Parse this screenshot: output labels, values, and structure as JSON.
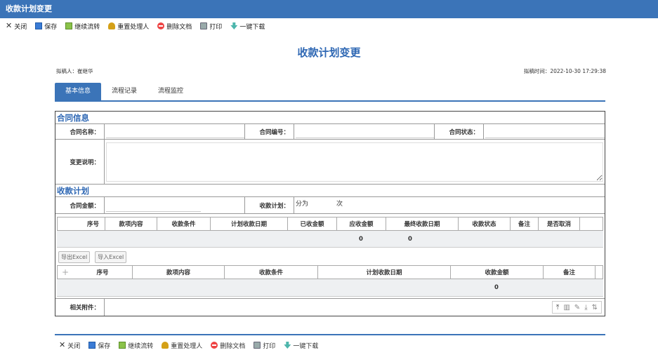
{
  "window": {
    "title": "收款计划变更"
  },
  "toolbar": {
    "items": [
      {
        "label": "关闭",
        "icon": "close-icon"
      },
      {
        "label": "保存",
        "icon": "save-icon"
      },
      {
        "label": "继续流转",
        "icon": "flow-icon"
      },
      {
        "label": "重置处理人",
        "icon": "user-icon"
      },
      {
        "label": "删除文档",
        "icon": "delete-icon"
      },
      {
        "label": "打印",
        "icon": "print-icon"
      },
      {
        "label": "一键下载",
        "icon": "download-icon"
      }
    ]
  },
  "page": {
    "title": "收款计划变更",
    "drafter": "拟稿人：崔继华",
    "draft_time": "拟稿时间：2022-10-30 17:29:38"
  },
  "tabs": [
    "基本信息",
    "流程记录",
    "流程监控"
  ],
  "contract": {
    "section_title": "合同信息",
    "name_label": "合同名称：",
    "number_label": "合同编号：",
    "status_label": "合同状态：",
    "desc_label": "变更说明："
  },
  "plan": {
    "section_title": "收款计划",
    "amount_label": "合同金额：",
    "plan_label": "收款计划：",
    "plan_prefix": "分为",
    "plan_suffix": "次",
    "grid1": {
      "headers": [
        "序号",
        "款项内容",
        "收款条件",
        "计划收款日期",
        "已收金额",
        "应收金额",
        "最终收款日期",
        "收款状态",
        "备注",
        "是否取消"
      ],
      "totals": {
        "received": "0",
        "receivable": "0"
      }
    },
    "export_btn": "导出Excel",
    "import_btn": "导入Excel",
    "grid2": {
      "add_icon": "+",
      "headers": [
        "序号",
        "款项内容",
        "收款条件",
        "计划收款日期",
        "收款金额",
        "备注"
      ],
      "totals": {
        "amount": "0"
      }
    },
    "attach_label": "相关附件："
  },
  "bottom_toolbar": {
    "items": [
      "关闭",
      "保存",
      "继续流转",
      "重置处理人",
      "删除文档",
      "打印",
      "一键下载"
    ]
  }
}
